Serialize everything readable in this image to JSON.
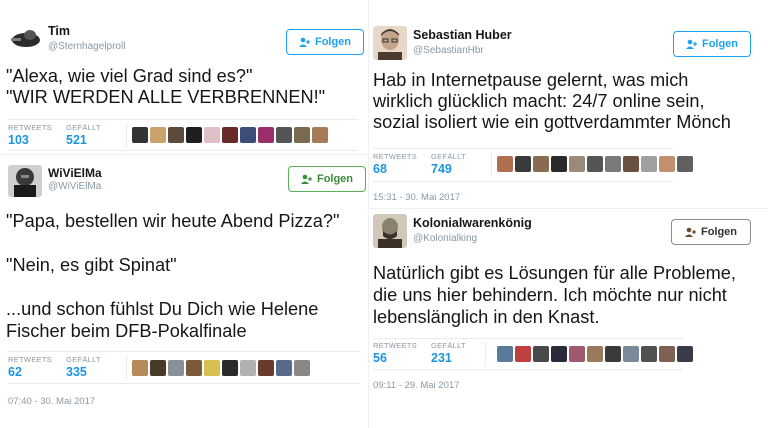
{
  "tweets": {
    "tim": {
      "name": "Tim",
      "handle": "@Sternhagelproll",
      "follow": "Folgen",
      "lines": [
        "\"Alexa, wie viel Grad sind es?\"",
        "\"WIR WERDEN ALLE VERBRENNEN!\""
      ],
      "retweets_label": "RETWEETS",
      "retweets": "103",
      "likes_label": "GEFÄLLT",
      "likes": "521",
      "avatar_colors": [
        "#4a4a4a",
        "#2b2b2b",
        "#7d7d7d"
      ],
      "liker_colors": [
        "#333333",
        "#c9a36b",
        "#5d4a3a",
        "#1f1f1f",
        "#e0c0c8",
        "#6b2a2a",
        "#3d4d7a",
        "#9a2f6b",
        "#555555",
        "#7a6a50",
        "#a57b5a"
      ]
    },
    "wivielma": {
      "name": "WiViElMa",
      "handle": "@WiViElMa",
      "follow": "Folgen",
      "lines": [
        "\"Papa, bestellen wir heute Abend Pizza?\"",
        "",
        "\"Nein, es gibt Spinat\"",
        "",
        "...und schon fühlst Du Dich wie Helene",
        "Fischer beim DFB-Pokalfinale"
      ],
      "retweets_label": "RETWEETS",
      "retweets": "62",
      "likes_label": "GEFÄLLT",
      "likes": "335",
      "time": "07:40 - 30. Mai 2017",
      "avatar_colors": [
        "#3a3a3a",
        "#1a1a1a",
        "#888888"
      ],
      "liker_colors": [
        "#b58a5a",
        "#4a3a2a",
        "#8a9098",
        "#7a5a3a",
        "#d8c050",
        "#2a2a2a",
        "#b0b0b0",
        "#6a3a2a",
        "#5a6a8a",
        "#888888"
      ]
    },
    "sebastian": {
      "name": "Sebastian Huber",
      "handle": "@SebastianHbr",
      "follow": "Folgen",
      "lines": [
        "Hab in Internetpause gelernt, was mich",
        "wirklich glücklich macht: 24/7 online sein,",
        "sozial isoliert wie ein gottverdammter Mönch"
      ],
      "retweets_label": "RETWEETS",
      "retweets": "68",
      "likes_label": "GEFÄLLT",
      "likes": "749",
      "time": "15:31 - 30. Mai 2017",
      "avatar_colors": [
        "#c7a58a",
        "#4a3a30",
        "#e8d8c8"
      ],
      "liker_colors": [
        "#b07050",
        "#3a3a3a",
        "#8a6a50",
        "#2a2a2a",
        "#9a8a7a",
        "#555555",
        "#7a7a7a",
        "#6a5040",
        "#a0a0a0",
        "#c09070",
        "#606060"
      ]
    },
    "kolonial": {
      "name": "Kolonialwarenkönig",
      "handle": "@Kolonialking",
      "follow": "Folgen",
      "lines": [
        "Natürlich gibt es Lösungen für alle Probleme,",
        "die uns hier behindern. Ich möchte nur nicht",
        "lebenslänglich in den Knast."
      ],
      "retweets_label": "RETWEETS",
      "retweets": "56",
      "likes_label": "GEFÄLLT",
      "likes": "231",
      "time": "09:11 - 29. Mai 2017",
      "avatar_colors": [
        "#8a8070",
        "#3a3028",
        "#d0c8b8"
      ],
      "liker_colors": [
        "#5a7a9a",
        "#c04040",
        "#4a4a4a",
        "#2a2a3a",
        "#a05a70",
        "#9a7a5a",
        "#3a3a3a",
        "#7a8a9a",
        "#505050",
        "#806050",
        "#3a3a4a"
      ]
    }
  }
}
